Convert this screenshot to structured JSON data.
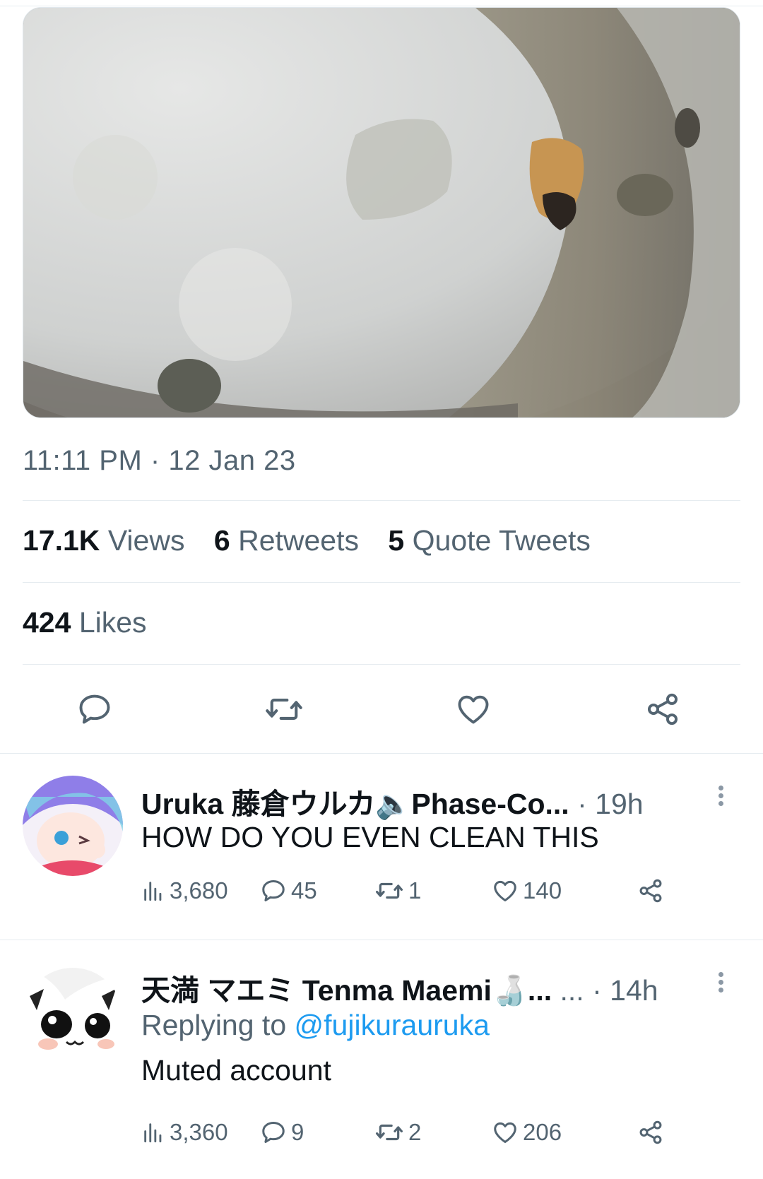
{
  "tweet": {
    "time": "11:11 PM",
    "separator": "·",
    "date": "12 Jan 23",
    "views_count": "17.1K",
    "views_label": "Views",
    "retweets_count": "6",
    "retweets_label": "Retweets",
    "quotes_count": "5",
    "quotes_label": "Quote Tweets",
    "likes_count": "424",
    "likes_label": "Likes"
  },
  "actions": {
    "reply_icon": "reply-icon",
    "retweet_icon": "retweet-icon",
    "like_icon": "heart-icon",
    "share_icon": "share-icon"
  },
  "replies": [
    {
      "name": "Uruka 藤倉ウルカ🔈Phase-Co...",
      "time": "· 19h",
      "text": "HOW DO YOU EVEN CLEAN THIS",
      "views": "3,680",
      "comments": "45",
      "retweets": "1",
      "likes": "140"
    },
    {
      "name": "天満 マエミ Tenma Maemi🍶...",
      "ellipsis": "...",
      "time": "· 14h",
      "replying_label": "Replying to",
      "replying_handle": "@fujikurauruka",
      "text": "Muted account",
      "views": "3,360",
      "comments": "9",
      "retweets": "2",
      "likes": "206"
    }
  ],
  "colors": {
    "accent": "#1d9bf0",
    "muted_text": "#536471",
    "divider": "#e6ecf0"
  }
}
